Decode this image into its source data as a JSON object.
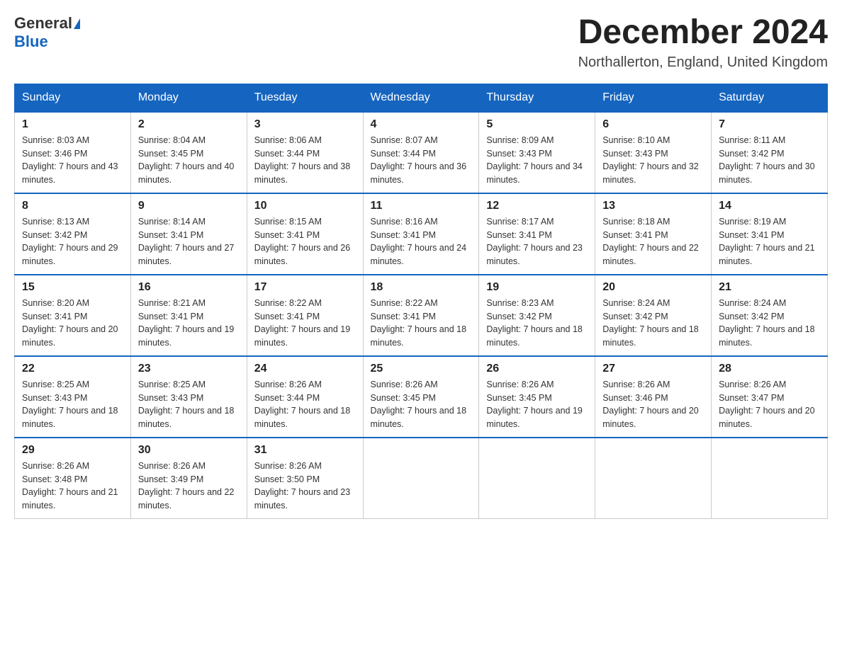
{
  "header": {
    "logo_line1": "General",
    "logo_line2": "Blue",
    "month_title": "December 2024",
    "location": "Northallerton, England, United Kingdom"
  },
  "weekdays": [
    "Sunday",
    "Monday",
    "Tuesday",
    "Wednesday",
    "Thursday",
    "Friday",
    "Saturday"
  ],
  "weeks": [
    [
      {
        "day": "1",
        "sunrise": "8:03 AM",
        "sunset": "3:46 PM",
        "daylight": "7 hours and 43 minutes."
      },
      {
        "day": "2",
        "sunrise": "8:04 AM",
        "sunset": "3:45 PM",
        "daylight": "7 hours and 40 minutes."
      },
      {
        "day": "3",
        "sunrise": "8:06 AM",
        "sunset": "3:44 PM",
        "daylight": "7 hours and 38 minutes."
      },
      {
        "day": "4",
        "sunrise": "8:07 AM",
        "sunset": "3:44 PM",
        "daylight": "7 hours and 36 minutes."
      },
      {
        "day": "5",
        "sunrise": "8:09 AM",
        "sunset": "3:43 PM",
        "daylight": "7 hours and 34 minutes."
      },
      {
        "day": "6",
        "sunrise": "8:10 AM",
        "sunset": "3:43 PM",
        "daylight": "7 hours and 32 minutes."
      },
      {
        "day": "7",
        "sunrise": "8:11 AM",
        "sunset": "3:42 PM",
        "daylight": "7 hours and 30 minutes."
      }
    ],
    [
      {
        "day": "8",
        "sunrise": "8:13 AM",
        "sunset": "3:42 PM",
        "daylight": "7 hours and 29 minutes."
      },
      {
        "day": "9",
        "sunrise": "8:14 AM",
        "sunset": "3:41 PM",
        "daylight": "7 hours and 27 minutes."
      },
      {
        "day": "10",
        "sunrise": "8:15 AM",
        "sunset": "3:41 PM",
        "daylight": "7 hours and 26 minutes."
      },
      {
        "day": "11",
        "sunrise": "8:16 AM",
        "sunset": "3:41 PM",
        "daylight": "7 hours and 24 minutes."
      },
      {
        "day": "12",
        "sunrise": "8:17 AM",
        "sunset": "3:41 PM",
        "daylight": "7 hours and 23 minutes."
      },
      {
        "day": "13",
        "sunrise": "8:18 AM",
        "sunset": "3:41 PM",
        "daylight": "7 hours and 22 minutes."
      },
      {
        "day": "14",
        "sunrise": "8:19 AM",
        "sunset": "3:41 PM",
        "daylight": "7 hours and 21 minutes."
      }
    ],
    [
      {
        "day": "15",
        "sunrise": "8:20 AM",
        "sunset": "3:41 PM",
        "daylight": "7 hours and 20 minutes."
      },
      {
        "day": "16",
        "sunrise": "8:21 AM",
        "sunset": "3:41 PM",
        "daylight": "7 hours and 19 minutes."
      },
      {
        "day": "17",
        "sunrise": "8:22 AM",
        "sunset": "3:41 PM",
        "daylight": "7 hours and 19 minutes."
      },
      {
        "day": "18",
        "sunrise": "8:22 AM",
        "sunset": "3:41 PM",
        "daylight": "7 hours and 18 minutes."
      },
      {
        "day": "19",
        "sunrise": "8:23 AM",
        "sunset": "3:42 PM",
        "daylight": "7 hours and 18 minutes."
      },
      {
        "day": "20",
        "sunrise": "8:24 AM",
        "sunset": "3:42 PM",
        "daylight": "7 hours and 18 minutes."
      },
      {
        "day": "21",
        "sunrise": "8:24 AM",
        "sunset": "3:42 PM",
        "daylight": "7 hours and 18 minutes."
      }
    ],
    [
      {
        "day": "22",
        "sunrise": "8:25 AM",
        "sunset": "3:43 PM",
        "daylight": "7 hours and 18 minutes."
      },
      {
        "day": "23",
        "sunrise": "8:25 AM",
        "sunset": "3:43 PM",
        "daylight": "7 hours and 18 minutes."
      },
      {
        "day": "24",
        "sunrise": "8:26 AM",
        "sunset": "3:44 PM",
        "daylight": "7 hours and 18 minutes."
      },
      {
        "day": "25",
        "sunrise": "8:26 AM",
        "sunset": "3:45 PM",
        "daylight": "7 hours and 18 minutes."
      },
      {
        "day": "26",
        "sunrise": "8:26 AM",
        "sunset": "3:45 PM",
        "daylight": "7 hours and 19 minutes."
      },
      {
        "day": "27",
        "sunrise": "8:26 AM",
        "sunset": "3:46 PM",
        "daylight": "7 hours and 20 minutes."
      },
      {
        "day": "28",
        "sunrise": "8:26 AM",
        "sunset": "3:47 PM",
        "daylight": "7 hours and 20 minutes."
      }
    ],
    [
      {
        "day": "29",
        "sunrise": "8:26 AM",
        "sunset": "3:48 PM",
        "daylight": "7 hours and 21 minutes."
      },
      {
        "day": "30",
        "sunrise": "8:26 AM",
        "sunset": "3:49 PM",
        "daylight": "7 hours and 22 minutes."
      },
      {
        "day": "31",
        "sunrise": "8:26 AM",
        "sunset": "3:50 PM",
        "daylight": "7 hours and 23 minutes."
      },
      null,
      null,
      null,
      null
    ]
  ]
}
